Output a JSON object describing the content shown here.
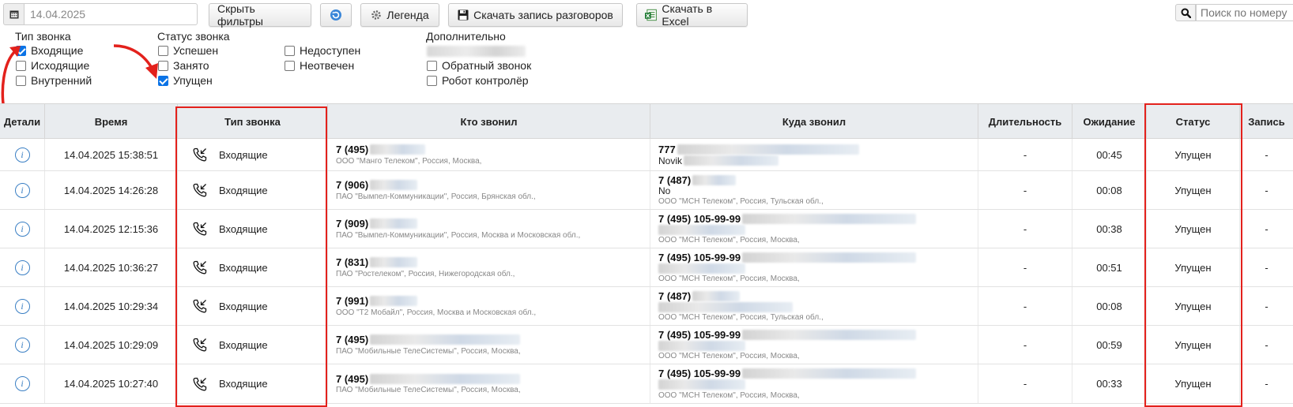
{
  "toolbar": {
    "date_value": "14.04.2025",
    "hide_filters_label": "Скрыть фильтры",
    "legend_label": "Легенда",
    "download_calls_label": "Скачать запись разговоров",
    "download_excel_label": "Скачать в Excel",
    "search_placeholder": "Поиск по номеру"
  },
  "filters": {
    "call_type": {
      "title": "Тип звонка",
      "items": [
        {
          "label": "Входящие",
          "checked": true
        },
        {
          "label": "Исходящие",
          "checked": false
        },
        {
          "label": "Внутренний",
          "checked": false
        }
      ]
    },
    "call_status": {
      "title": "Статус звонка",
      "items": [
        {
          "label": "Успешен",
          "checked": false
        },
        {
          "label": "Занято",
          "checked": false
        },
        {
          "label": "Упущен",
          "checked": true
        },
        {
          "label": "Недоступен",
          "checked": false
        },
        {
          "label": "Неотвечен",
          "checked": false
        }
      ]
    },
    "extra": {
      "title": "Дополнительно",
      "items": [
        {
          "label": "Обратный звонок",
          "checked": false
        },
        {
          "label": "Робот контролёр",
          "checked": false
        }
      ]
    }
  },
  "table": {
    "headers": [
      "Детали",
      "Время",
      "Тип звонка",
      "Кто звонил",
      "Куда звонил",
      "Длительность",
      "Ожидание",
      "Статус",
      "Запись"
    ],
    "rows": [
      {
        "time": "14.04.2025 15:38:51",
        "type": "Входящие",
        "from_num": "7 (495)",
        "from_sub": "ООО \"Манго Телеком\", Россия, Москва,",
        "to_num": "777",
        "to_mid": "Novik",
        "to_sub": "",
        "duration": "-",
        "wait": "00:45",
        "status": "Упущен",
        "record": "-"
      },
      {
        "time": "14.04.2025 14:26:28",
        "type": "Входящие",
        "from_num": "7 (906)",
        "from_sub": "ПАО \"Вымпел-Коммуникации\", Россия, Брянская обл.,",
        "to_num": "7 (487)",
        "to_mid": "No",
        "to_sub": "ООО \"МСН Телеком\", Россия, Тульская обл.,",
        "duration": "-",
        "wait": "00:08",
        "status": "Упущен",
        "record": "-"
      },
      {
        "time": "14.04.2025 12:15:36",
        "type": "Входящие",
        "from_num": "7 (909)",
        "from_sub": "ПАО \"Вымпел-Коммуникации\", Россия, Москва и Московская обл.,",
        "to_num": "7 (495) 105-99-99",
        "to_mid": "",
        "to_sub": "ООО \"МСН Телеком\", Россия, Москва,",
        "duration": "-",
        "wait": "00:38",
        "status": "Упущен",
        "record": "-"
      },
      {
        "time": "14.04.2025 10:36:27",
        "type": "Входящие",
        "from_num": "7 (831)",
        "from_sub": "ПАО \"Ростелеком\", Россия, Нижегородская обл.,",
        "to_num": "7 (495) 105-99-99",
        "to_mid": "",
        "to_sub": "ООО \"МСН Телеком\", Россия, Москва,",
        "duration": "-",
        "wait": "00:51",
        "status": "Упущен",
        "record": "-"
      },
      {
        "time": "14.04.2025 10:29:34",
        "type": "Входящие",
        "from_num": "7 (991)",
        "from_sub": "ООО \"Т2 Мобайл\", Россия, Москва и Московская обл.,",
        "to_num": "7 (487)",
        "to_mid": "",
        "to_sub": "ООО \"МСН Телеком\", Россия, Тульская обл.,",
        "duration": "-",
        "wait": "00:08",
        "status": "Упущен",
        "record": "-"
      },
      {
        "time": "14.04.2025 10:29:09",
        "type": "Входящие",
        "from_num": "7 (495)",
        "from_sub": "ПАО \"Мобильные ТелеСистемы\", Россия, Москва,",
        "to_num": "7 (495) 105-99-99",
        "to_mid": "",
        "to_sub": "ООО \"МСН Телеком\", Россия, Москва,",
        "duration": "-",
        "wait": "00:59",
        "status": "Упущен",
        "record": "-"
      },
      {
        "time": "14.04.2025 10:27:40",
        "type": "Входящие",
        "from_num": "7 (495)",
        "from_sub": "ПАО \"Мобильные ТелеСистемы\", Россия, Москва,",
        "to_num": "7 (495) 105-99-99",
        "to_mid": "",
        "to_sub": "ООО \"МСН Телеком\", Россия, Москва,",
        "duration": "-",
        "wait": "00:33",
        "status": "Упущен",
        "record": "-"
      }
    ]
  },
  "colors": {
    "highlight_box": "#e3211c",
    "checkbox_checked": "#0b73e6",
    "info_icon": "#3a7fc4",
    "header_bg": "#e9ecef"
  },
  "icons": {
    "date": "calendar-icon",
    "legend": "gear-icon",
    "download_calls": "floppy-disk-icon",
    "download_excel": "excel-icon",
    "refresh": "refresh-icon",
    "search": "search-icon",
    "details": "info-icon",
    "call_type": "incoming-call-icon"
  }
}
